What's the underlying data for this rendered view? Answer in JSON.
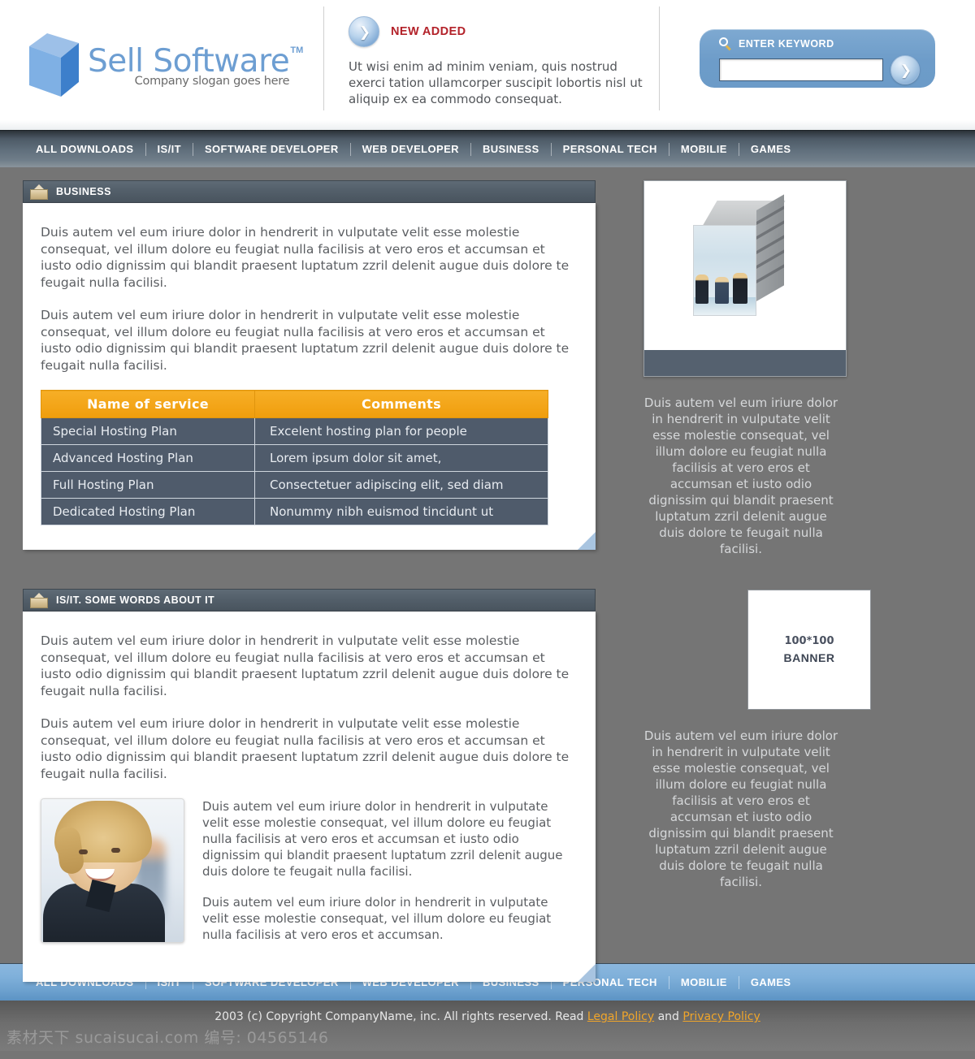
{
  "header": {
    "logo": {
      "title": "Sell Software",
      "tm": "TM",
      "slogan": "Company slogan goes here",
      "icon": "cube-icon"
    },
    "promo": {
      "icon": "arrow-right-circle-icon",
      "title": "NEW ADDED",
      "body": "Ut wisi enim ad minim veniam, quis nostrud exerci tation ullamcorper suscipit lobortis nisl ut aliquip ex ea commodo consequat."
    },
    "search": {
      "icon": "magnifier-icon",
      "label": "ENTER KEYWORD",
      "value": "",
      "placeholder": "",
      "submit_icon": "arrow-right-circle-icon"
    }
  },
  "nav": {
    "items": [
      "ALL DOWNLOADS",
      "IS/IT",
      "SOFTWARE DEVELOPER",
      "WEB DEVELOPER",
      "BUSINESS",
      "PERSONAL TECH",
      "MOBILIE",
      "GAMES"
    ]
  },
  "panels": [
    {
      "icon": "folder-icon",
      "title": "BUSINESS",
      "paragraphs": [
        "Duis autem vel eum iriure dolor in hendrerit in vulputate velit esse molestie consequat, vel illum dolore eu feugiat nulla facilisis at vero eros et accumsan et iusto odio dignissim qui blandit praesent luptatum zzril delenit augue duis dolore te feugait nulla facilisi.",
        "Duis autem vel eum iriure dolor in hendrerit in vulputate velit esse molestie consequat, vel illum dolore eu feugiat nulla facilisis at vero eros et accumsan et iusto odio dignissim qui blandit praesent luptatum zzril delenit augue duis dolore te feugait nulla facilisi."
      ],
      "table": {
        "headers": [
          "Name of service",
          "Comments"
        ],
        "rows": [
          [
            "Special Hosting Plan",
            "Excelent hosting plan for people"
          ],
          [
            "Advanced Hosting Plan",
            "Lorem ipsum dolor sit amet,"
          ],
          [
            "Full Hosting Plan",
            "Consectetuer adipiscing elit, sed diam"
          ],
          [
            "Dedicated Hosting Plan",
            "Nonummy nibh euismod tincidunt ut"
          ]
        ]
      }
    },
    {
      "icon": "folder-icon",
      "title": "IS/IT. SOME WORDS ABOUT IT",
      "paragraphs": [
        "Duis autem vel eum iriure dolor in hendrerit in vulputate velit esse molestie consequat, vel illum dolore eu feugiat nulla facilisis at vero eros et accumsan et iusto odio dignissim qui blandit praesent luptatum zzril delenit augue duis dolore te feugait nulla facilisi.",
        "Duis autem vel eum iriure dolor in hendrerit in vulputate velit esse molestie consequat, vel illum dolore eu feugiat nulla facilisis at vero eros et accumsan et iusto odio dignissim qui blandit praesent luptatum zzril delenit augue duis dolore te feugait nulla facilisi."
      ],
      "photo_alt": "smiling-businesswoman-photo",
      "photo_paragraphs": [
        "Duis autem vel eum iriure dolor in hendrerit in vulputate velit esse molestie consequat, vel illum dolore eu feugiat nulla facilisis at vero eros et accumsan et iusto odio dignissim qui blandit praesent luptatum zzril delenit augue duis dolore te feugait nulla facilisi.",
        "Duis autem vel eum iriure dolor in hendrerit in vulputate velit esse molestie consequat, vel illum dolore eu feugiat nulla facilisis at vero eros et accumsan."
      ]
    }
  ],
  "sidebar": {
    "server_image_alt": "server-box-business-people-image",
    "text_top": "Duis autem vel eum iriure dolor in hendrerit in vulputate velit esse molestie consequat, vel illum dolore eu feugiat nulla facilisis at vero eros et accumsan et iusto odio dignissim qui blandit praesent luptatum zzril delenit augue duis dolore te feugait nulla facilisi.",
    "banner": {
      "size": "100*100",
      "label": "BANNER"
    },
    "text_bottom": "Duis autem vel eum iriure dolor in hendrerit in vulputate velit esse molestie consequat, vel illum dolore eu feugiat nulla facilisis at vero eros et accumsan et iusto odio dignissim qui blandit praesent luptatum zzril delenit augue duis dolore te feugait nulla facilisi."
  },
  "footer": {
    "nav_items": [
      "ALL DOWNLOADS",
      "IS/IT",
      "SOFTWARE DEVELOPER",
      "WEB DEVELOPER",
      "BUSINESS",
      "PERSONAL TECH",
      "MOBILIE",
      "GAMES"
    ],
    "copyright_pre": "2003 (c) Copyright CompanyName, inc. All rights reserved. Read ",
    "legal_link": "Legal Policy",
    "copyright_mid": " and ",
    "privacy_link": "Privacy Policy",
    "watermark": "素材天下 sucaisucai.com  编号: 04565146"
  },
  "colors": {
    "accent_blue": "#6d9ed2",
    "nav_dark": "#61707d",
    "table_header_orange": "#f3a417",
    "table_row_slate": "#4f5b6b",
    "link_orange": "#f0a52a",
    "page_bg": "#757575",
    "promo_red": "#b3222a"
  }
}
